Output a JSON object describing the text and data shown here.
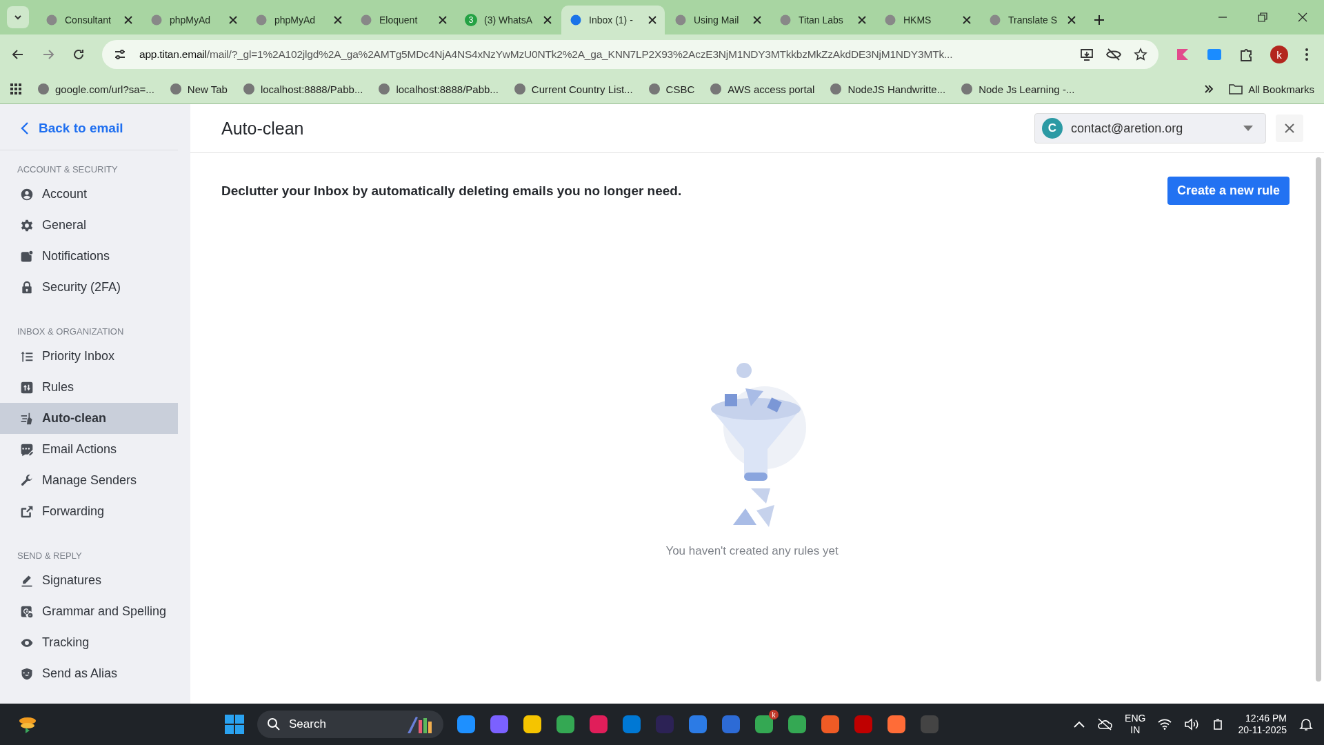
{
  "browser": {
    "tabs": [
      {
        "label": "Consultant",
        "selected": false
      },
      {
        "label": "phpMyAd",
        "selected": false
      },
      {
        "label": "phpMyAd",
        "selected": false
      },
      {
        "label": "Eloquent",
        "selected": false
      },
      {
        "label": "(3) WhatsA",
        "badge": "3",
        "selected": false
      },
      {
        "label": "Inbox (1) -",
        "selected": true
      },
      {
        "label": "Using Mail",
        "selected": false
      },
      {
        "label": "Titan Labs",
        "selected": false
      },
      {
        "label": "HKMS",
        "selected": false
      },
      {
        "label": "Translate S",
        "selected": false
      }
    ],
    "url_host": "app.titan.email",
    "url_path": "/mail/?_gl=1%2A102jlgd%2A_ga%2AMTg5MDc4NjA4NS4xNzYwMzU0NTk2%2A_ga_KNN7LP2X93%2AczE3NjM1NDY3MTkkbzMkZzAkdDE3NjM1NDY3MTk...",
    "profile_initial": "k",
    "bookmarks": [
      "google.com/url?sa=...",
      "New Tab",
      "localhost:8888/Pabb...",
      "localhost:8888/Pabb...",
      "Current Country List...",
      "CSBC",
      "AWS access portal",
      "NodeJS Handwritte...",
      "Node Js Learning -..."
    ],
    "all_bookmarks": "All Bookmarks"
  },
  "sidebar": {
    "back": "Back to email",
    "sections": [
      {
        "title": "ACCOUNT & SECURITY",
        "items": [
          {
            "label": "Account",
            "selected": false
          },
          {
            "label": "General",
            "selected": false
          },
          {
            "label": "Notifications",
            "selected": false
          },
          {
            "label": "Security (2FA)",
            "selected": false
          }
        ]
      },
      {
        "title": "INBOX & ORGANIZATION",
        "items": [
          {
            "label": "Priority Inbox",
            "selected": false
          },
          {
            "label": "Rules",
            "selected": false
          },
          {
            "label": "Auto-clean",
            "selected": true
          },
          {
            "label": "Email Actions",
            "selected": false
          },
          {
            "label": "Manage Senders",
            "selected": false
          },
          {
            "label": "Forwarding",
            "selected": false
          }
        ]
      },
      {
        "title": "SEND & REPLY",
        "items": [
          {
            "label": "Signatures",
            "selected": false
          },
          {
            "label": "Grammar and Spelling",
            "selected": false
          },
          {
            "label": "Tracking",
            "selected": false
          },
          {
            "label": "Send as Alias",
            "selected": false
          }
        ]
      }
    ]
  },
  "header": {
    "title": "Auto-clean",
    "account_initial": "C",
    "account": "contact@aretion.org"
  },
  "content": {
    "description": "Declutter your Inbox by automatically deleting emails you no longer need.",
    "button": "Create a new rule",
    "empty_message": "You haven't created any rules yet"
  },
  "taskbar": {
    "search": "Search",
    "chrome_badge": "k",
    "language": "ENG",
    "region": "IN",
    "time": "12:46 PM",
    "date": "20-11-2025"
  }
}
